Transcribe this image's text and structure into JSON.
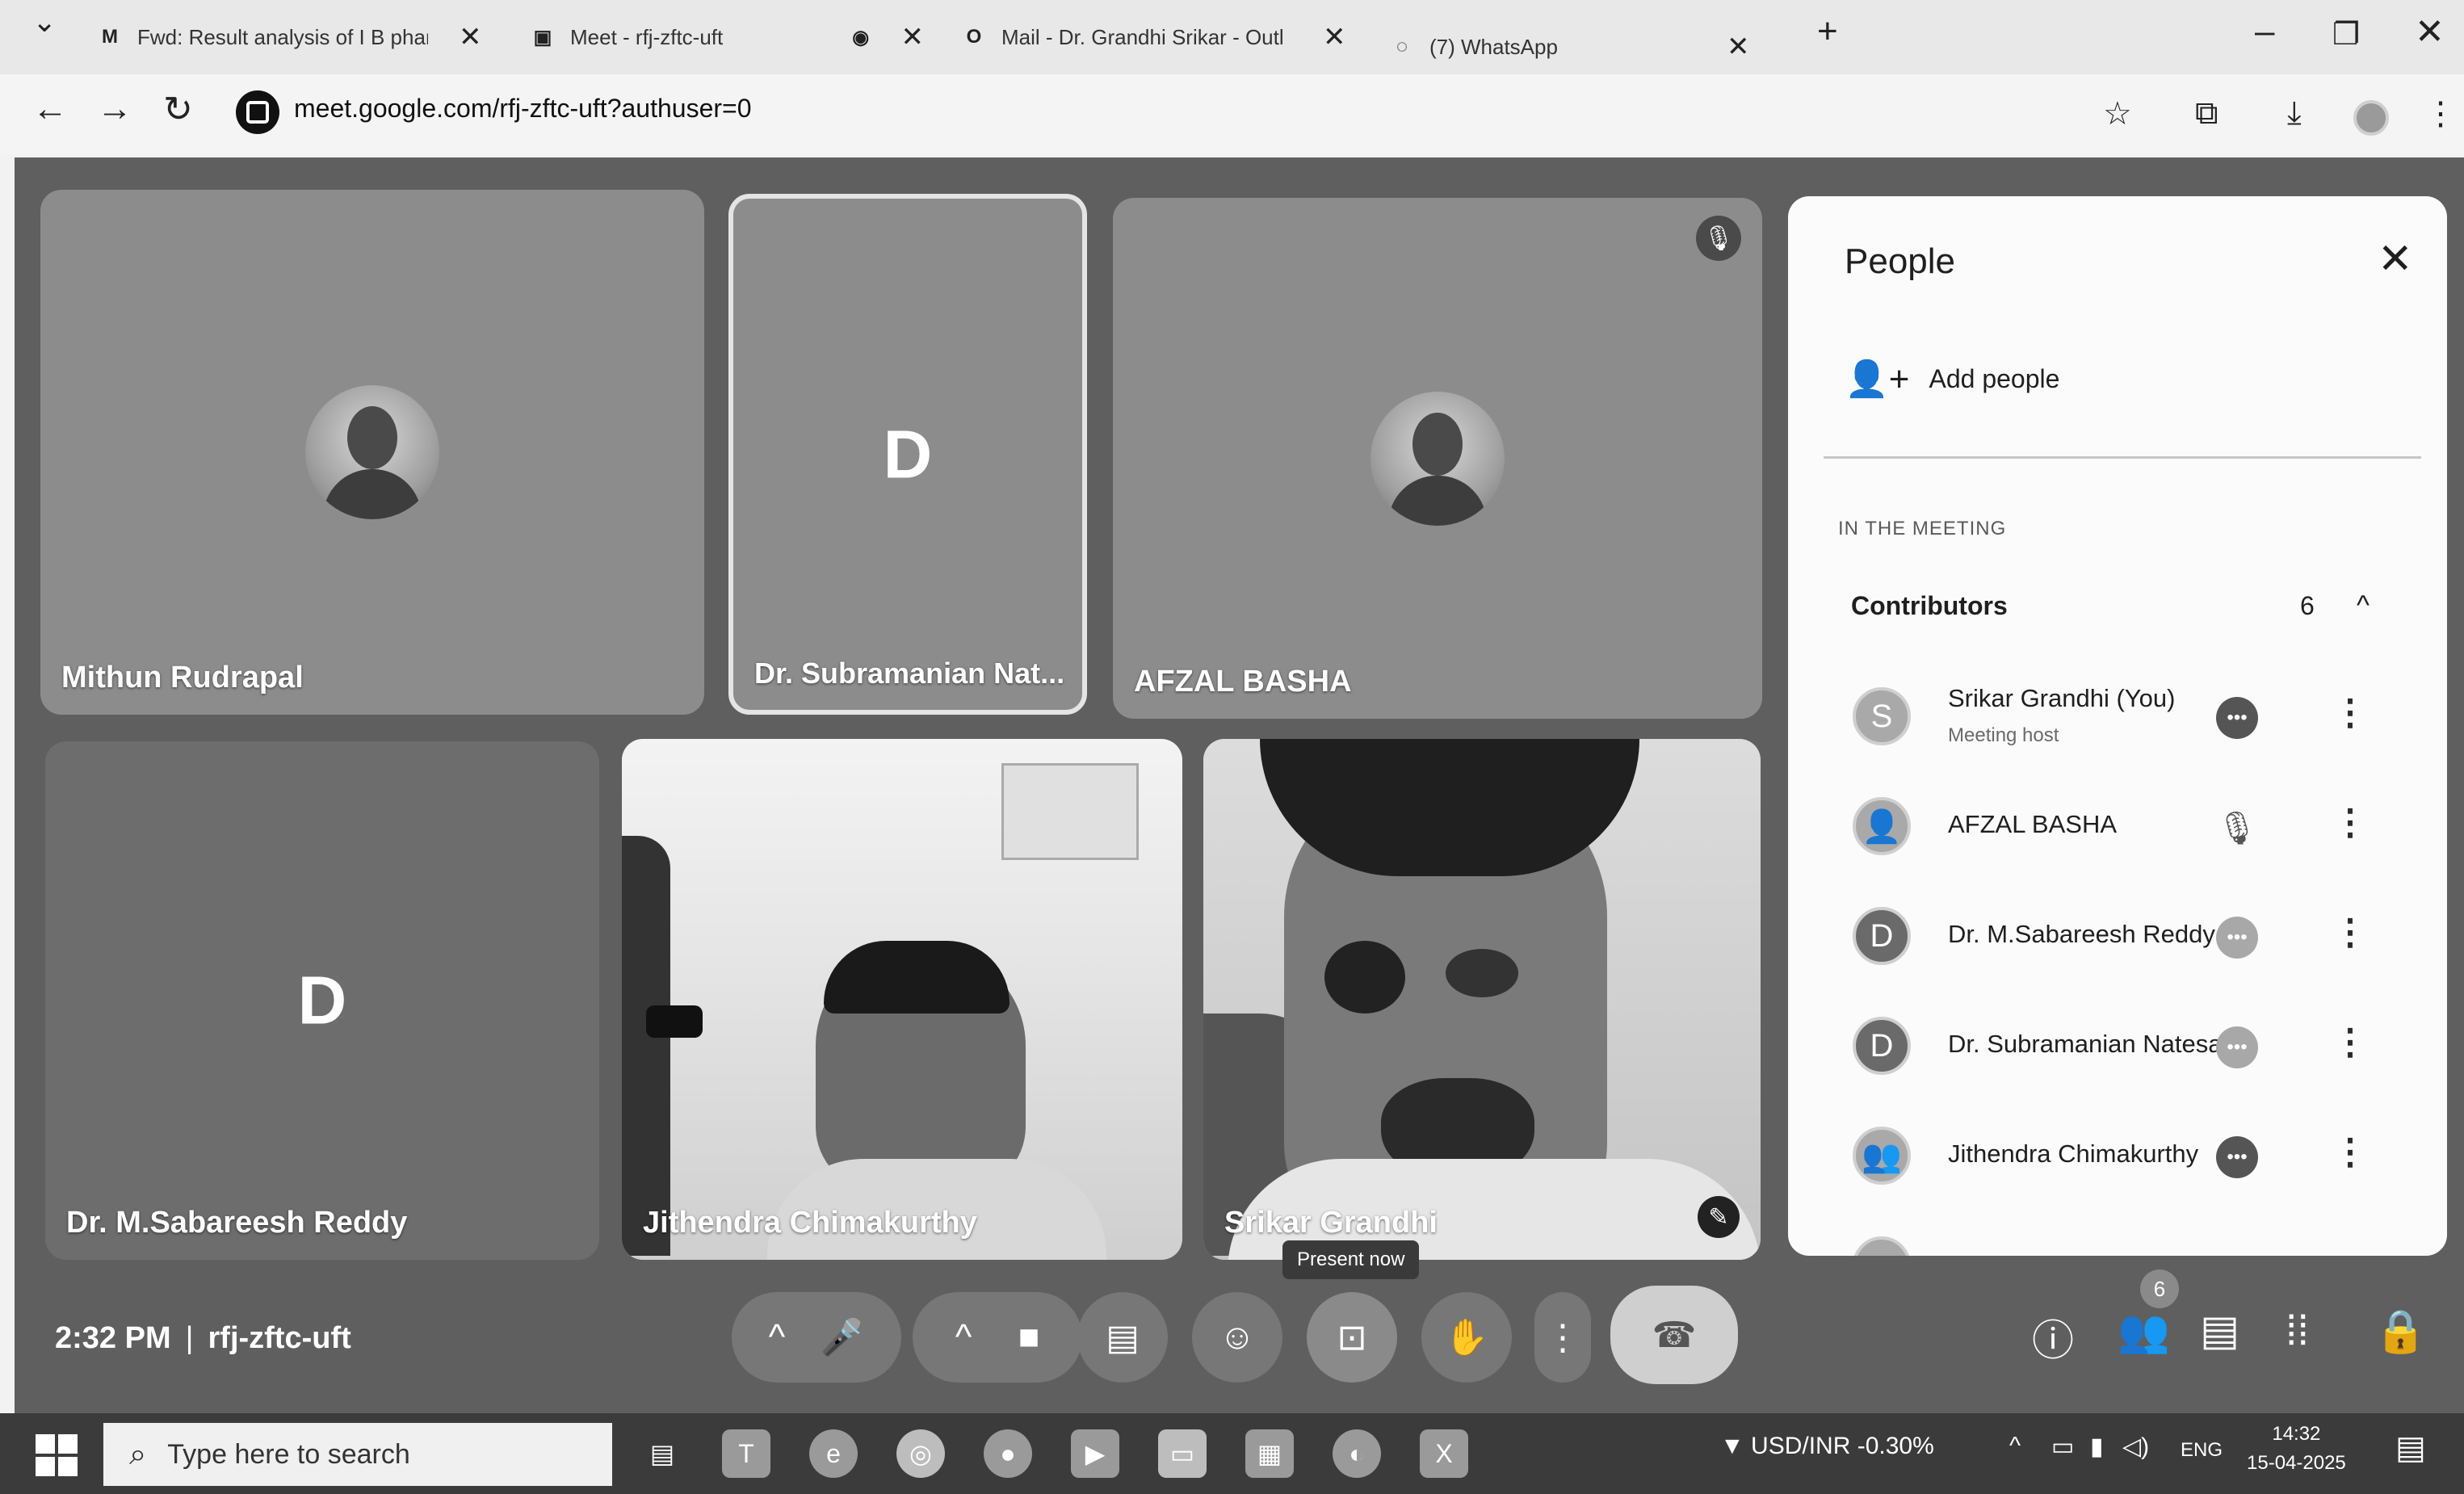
{
  "browser": {
    "tabs": [
      {
        "title": "Fwd: Result analysis of I B phar",
        "icon": "gmail-icon"
      },
      {
        "title": "Meet - rfj-zftc-uft",
        "icon": "meet-icon"
      },
      {
        "title": "",
        "icon": "record-icon"
      },
      {
        "title": "Mail - Dr. Grandhi Srikar - Outl",
        "icon": "outlook-icon"
      },
      {
        "title": "(7) WhatsApp",
        "icon": "whatsapp-icon"
      }
    ],
    "url": "meet.google.com/rfj-zftc-uft?authuser=0"
  },
  "meet": {
    "tiles": [
      {
        "name": "Mithun Rudrapal",
        "letter": ""
      },
      {
        "name": "Dr. Subramanian Nat...",
        "letter": "D"
      },
      {
        "name": "AFZAL BASHA",
        "letter": ""
      },
      {
        "name": "Dr. M.Sabareesh Reddy",
        "letter": "D"
      },
      {
        "name": "Jithendra Chimakurthy",
        "letter": ""
      },
      {
        "name": "Srikar Grandhi",
        "letter": ""
      }
    ],
    "time": "2:32 PM",
    "meeting_code": "rfj-zftc-uft",
    "tooltip": "Present now",
    "people_count": "6"
  },
  "people_panel": {
    "title": "People",
    "add_people": "Add people",
    "section_label": "IN THE MEETING",
    "group": {
      "label": "Contributors",
      "count": "6"
    },
    "participants": [
      {
        "name": "Srikar Grandhi (You)",
        "sub": "Meeting host",
        "initial": "S"
      },
      {
        "name": "AFZAL BASHA",
        "sub": "",
        "initial": ""
      },
      {
        "name": "Dr. M.Sabareesh Reddy",
        "sub": "",
        "initial": "D"
      },
      {
        "name": "Dr. Subramanian Natesan",
        "sub": "",
        "initial": "D"
      },
      {
        "name": "Jithendra Chimakurthy",
        "sub": "",
        "initial": ""
      }
    ]
  },
  "taskbar": {
    "search_placeholder": "Type here to search",
    "currency": "USD/INR",
    "currency_change": "-0.30%",
    "language": "ENG",
    "clock_time": "14:32",
    "clock_date": "15-04-2025"
  }
}
